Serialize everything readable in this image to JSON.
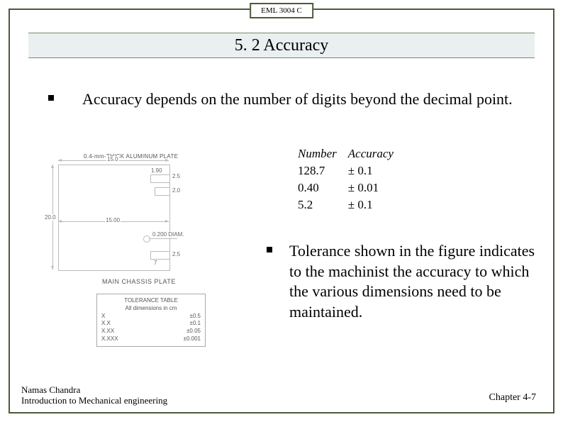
{
  "course_tag": "EML 3004 C",
  "title": "5. 2 Accuracy",
  "bullet1": "Accuracy depends on the number of digits  beyond the decimal point.",
  "bullet2": "Tolerance shown in the figure indicates to the machinist the accuracy to which the various dimensions need to be maintained.",
  "accuracy_table": {
    "headers": {
      "number": "Number",
      "accuracy": "Accuracy"
    },
    "rows": [
      {
        "number": "128.7",
        "accuracy": "± 0.1"
      },
      {
        "number": "0.40",
        "accuracy": "± 0.01"
      },
      {
        "number": "5.2",
        "accuracy": "± 0.1"
      }
    ]
  },
  "figure": {
    "note_top": "0.4-mm-THICK ALUMINUM PLATE",
    "title_mid": "MAIN CHASSIS PLATE",
    "dims": {
      "width_top": "15.0",
      "height_left": "20.0",
      "w_190": "1.90",
      "w_25a": "2.5",
      "w_20": "2.0",
      "width_mid": "15.00",
      "diam": "0.200 DIAM.",
      "w_25b": "2.5",
      "space": "7"
    },
    "tolerance_box": {
      "header1": "TOLERANCE TABLE",
      "header2": "All dimensions in cm",
      "rows": [
        {
          "pattern": "X",
          "tol": "±0.5"
        },
        {
          "pattern": "X.X",
          "tol": "±0.1"
        },
        {
          "pattern": "X.XX",
          "tol": "±0.05"
        },
        {
          "pattern": "X.XXX",
          "tol": "±0.001"
        }
      ]
    }
  },
  "footer": {
    "author": "Namas Chandra",
    "subtitle": "Introduction to Mechanical engineering",
    "chapter": "Chapter 4-7"
  }
}
